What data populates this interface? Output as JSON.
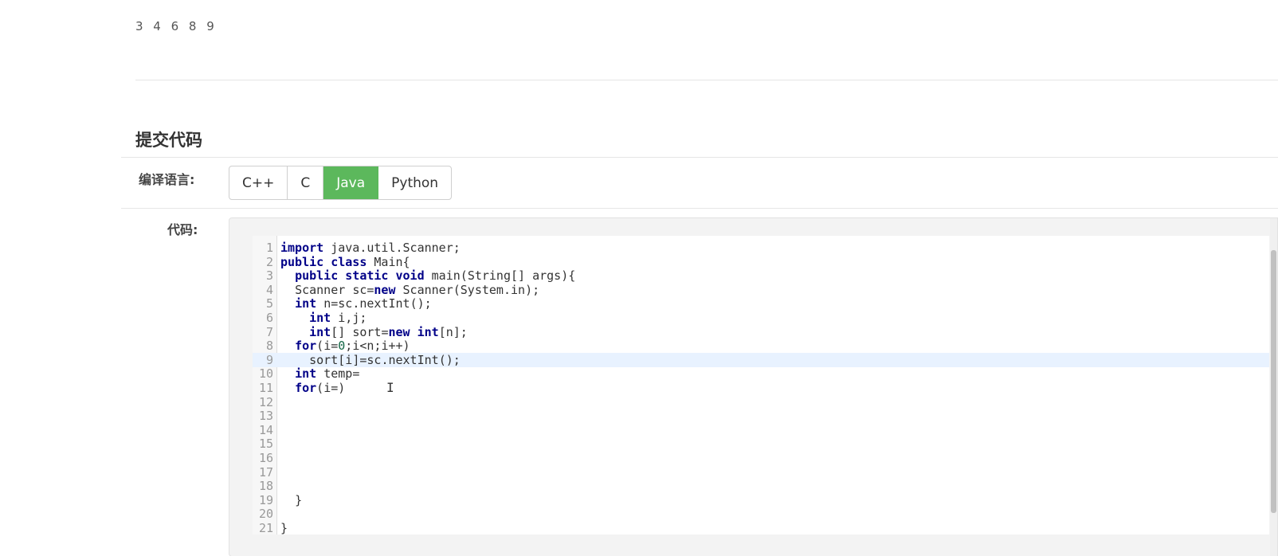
{
  "sample_output": "3 4 6 8 9",
  "submit_section": {
    "title": "提交代码",
    "language_label": "编译语言:",
    "code_label": "代码:",
    "languages": [
      {
        "label": "C++",
        "active": false
      },
      {
        "label": "C",
        "active": false
      },
      {
        "label": "Java",
        "active": true
      },
      {
        "label": "Python",
        "active": false
      }
    ]
  },
  "editor": {
    "active_line": 9,
    "lines": [
      {
        "n": "1",
        "text": "import java.util.Scanner;"
      },
      {
        "n": "2",
        "text": "public class Main{"
      },
      {
        "n": "3",
        "text": "  public static void main(String[] args){"
      },
      {
        "n": "4",
        "text": "  Scanner sc=new Scanner(System.in);"
      },
      {
        "n": "5",
        "text": "  int n=sc.nextInt();"
      },
      {
        "n": "6",
        "text": "    int i,j;"
      },
      {
        "n": "7",
        "text": "    int[] sort=new int[n];"
      },
      {
        "n": "8",
        "text": "  for(i=0;i<n;i++)"
      },
      {
        "n": "9",
        "text": "    sort[i]=sc.nextInt();"
      },
      {
        "n": "10",
        "text": "  int temp="
      },
      {
        "n": "11",
        "text": "  for(i=)"
      },
      {
        "n": "12",
        "text": ""
      },
      {
        "n": "13",
        "text": ""
      },
      {
        "n": "14",
        "text": ""
      },
      {
        "n": "15",
        "text": ""
      },
      {
        "n": "16",
        "text": ""
      },
      {
        "n": "17",
        "text": ""
      },
      {
        "n": "18",
        "text": ""
      },
      {
        "n": "19",
        "text": "  }"
      },
      {
        "n": "20",
        "text": ""
      },
      {
        "n": "21",
        "text": "}"
      }
    ]
  },
  "colors": {
    "active_language": "#5cb85c",
    "keyword": "#000088",
    "number": "#116644"
  }
}
